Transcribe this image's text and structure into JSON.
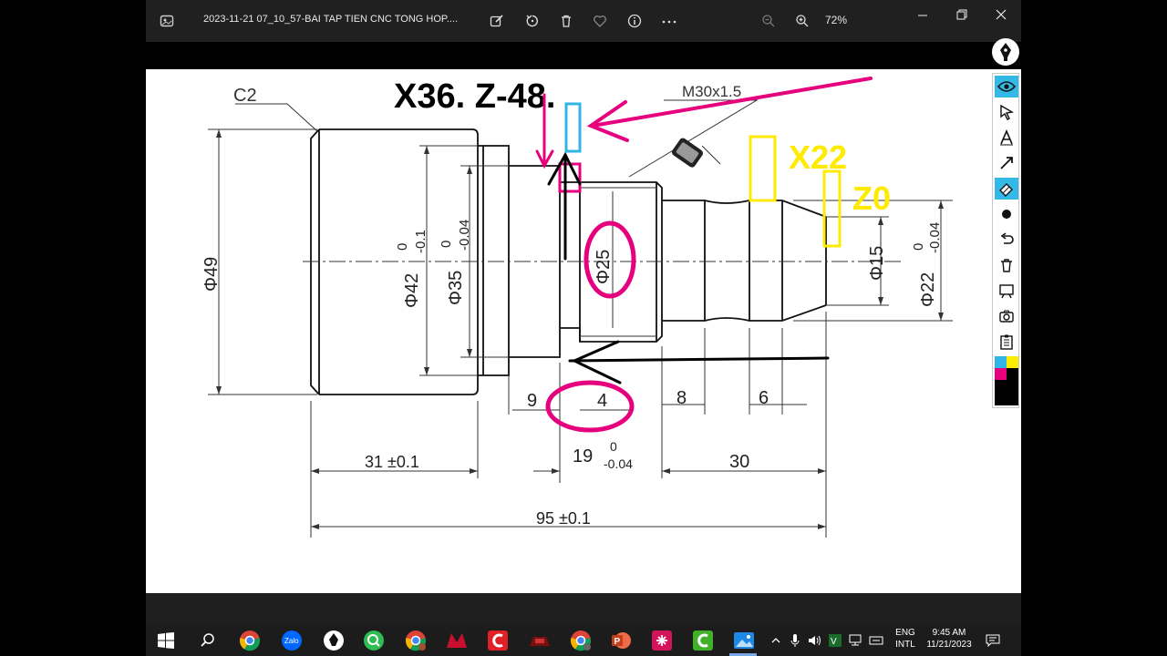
{
  "window": {
    "title": "2023-11-21 07_10_57-BAI TAP TIEN CNC TONG HOP....",
    "zoom": "72%"
  },
  "drawing": {
    "chamfer_label": "C2",
    "coord_label": "X36. Z-48.",
    "thread_label": "M30x1.5",
    "x_label": "X22",
    "z_label": "Z0",
    "diameters": {
      "d49": "Φ49",
      "d42": "Φ42",
      "d42_tol_upper": "0",
      "d42_tol_lower": "-0.1",
      "d35": "Φ35",
      "d35_tol_upper": "0",
      "d35_tol_lower": "-0.04",
      "d25": "Φ25",
      "d15": "Φ15",
      "d22": "Φ22",
      "d22_tol_upper": "0",
      "d22_tol_lower": "-0.04"
    },
    "lengths": {
      "l9": "9",
      "l4": "4",
      "l8": "8",
      "l6": "6",
      "l31": "31 ±0.1",
      "l19": "19",
      "l19_tol_upper": "0",
      "l19_tol_lower": "-0.04",
      "l30": "30",
      "l95": "95 ±0.1"
    }
  },
  "tray": {
    "lang": "ENG",
    "layout": "INTL",
    "time": "9:45 AM",
    "date": "11/21/2023"
  },
  "colors": {
    "magenta": "#e6007e",
    "yellow": "#ffeb00",
    "cyan": "#2fb6e6",
    "toolbar": "#202020"
  }
}
